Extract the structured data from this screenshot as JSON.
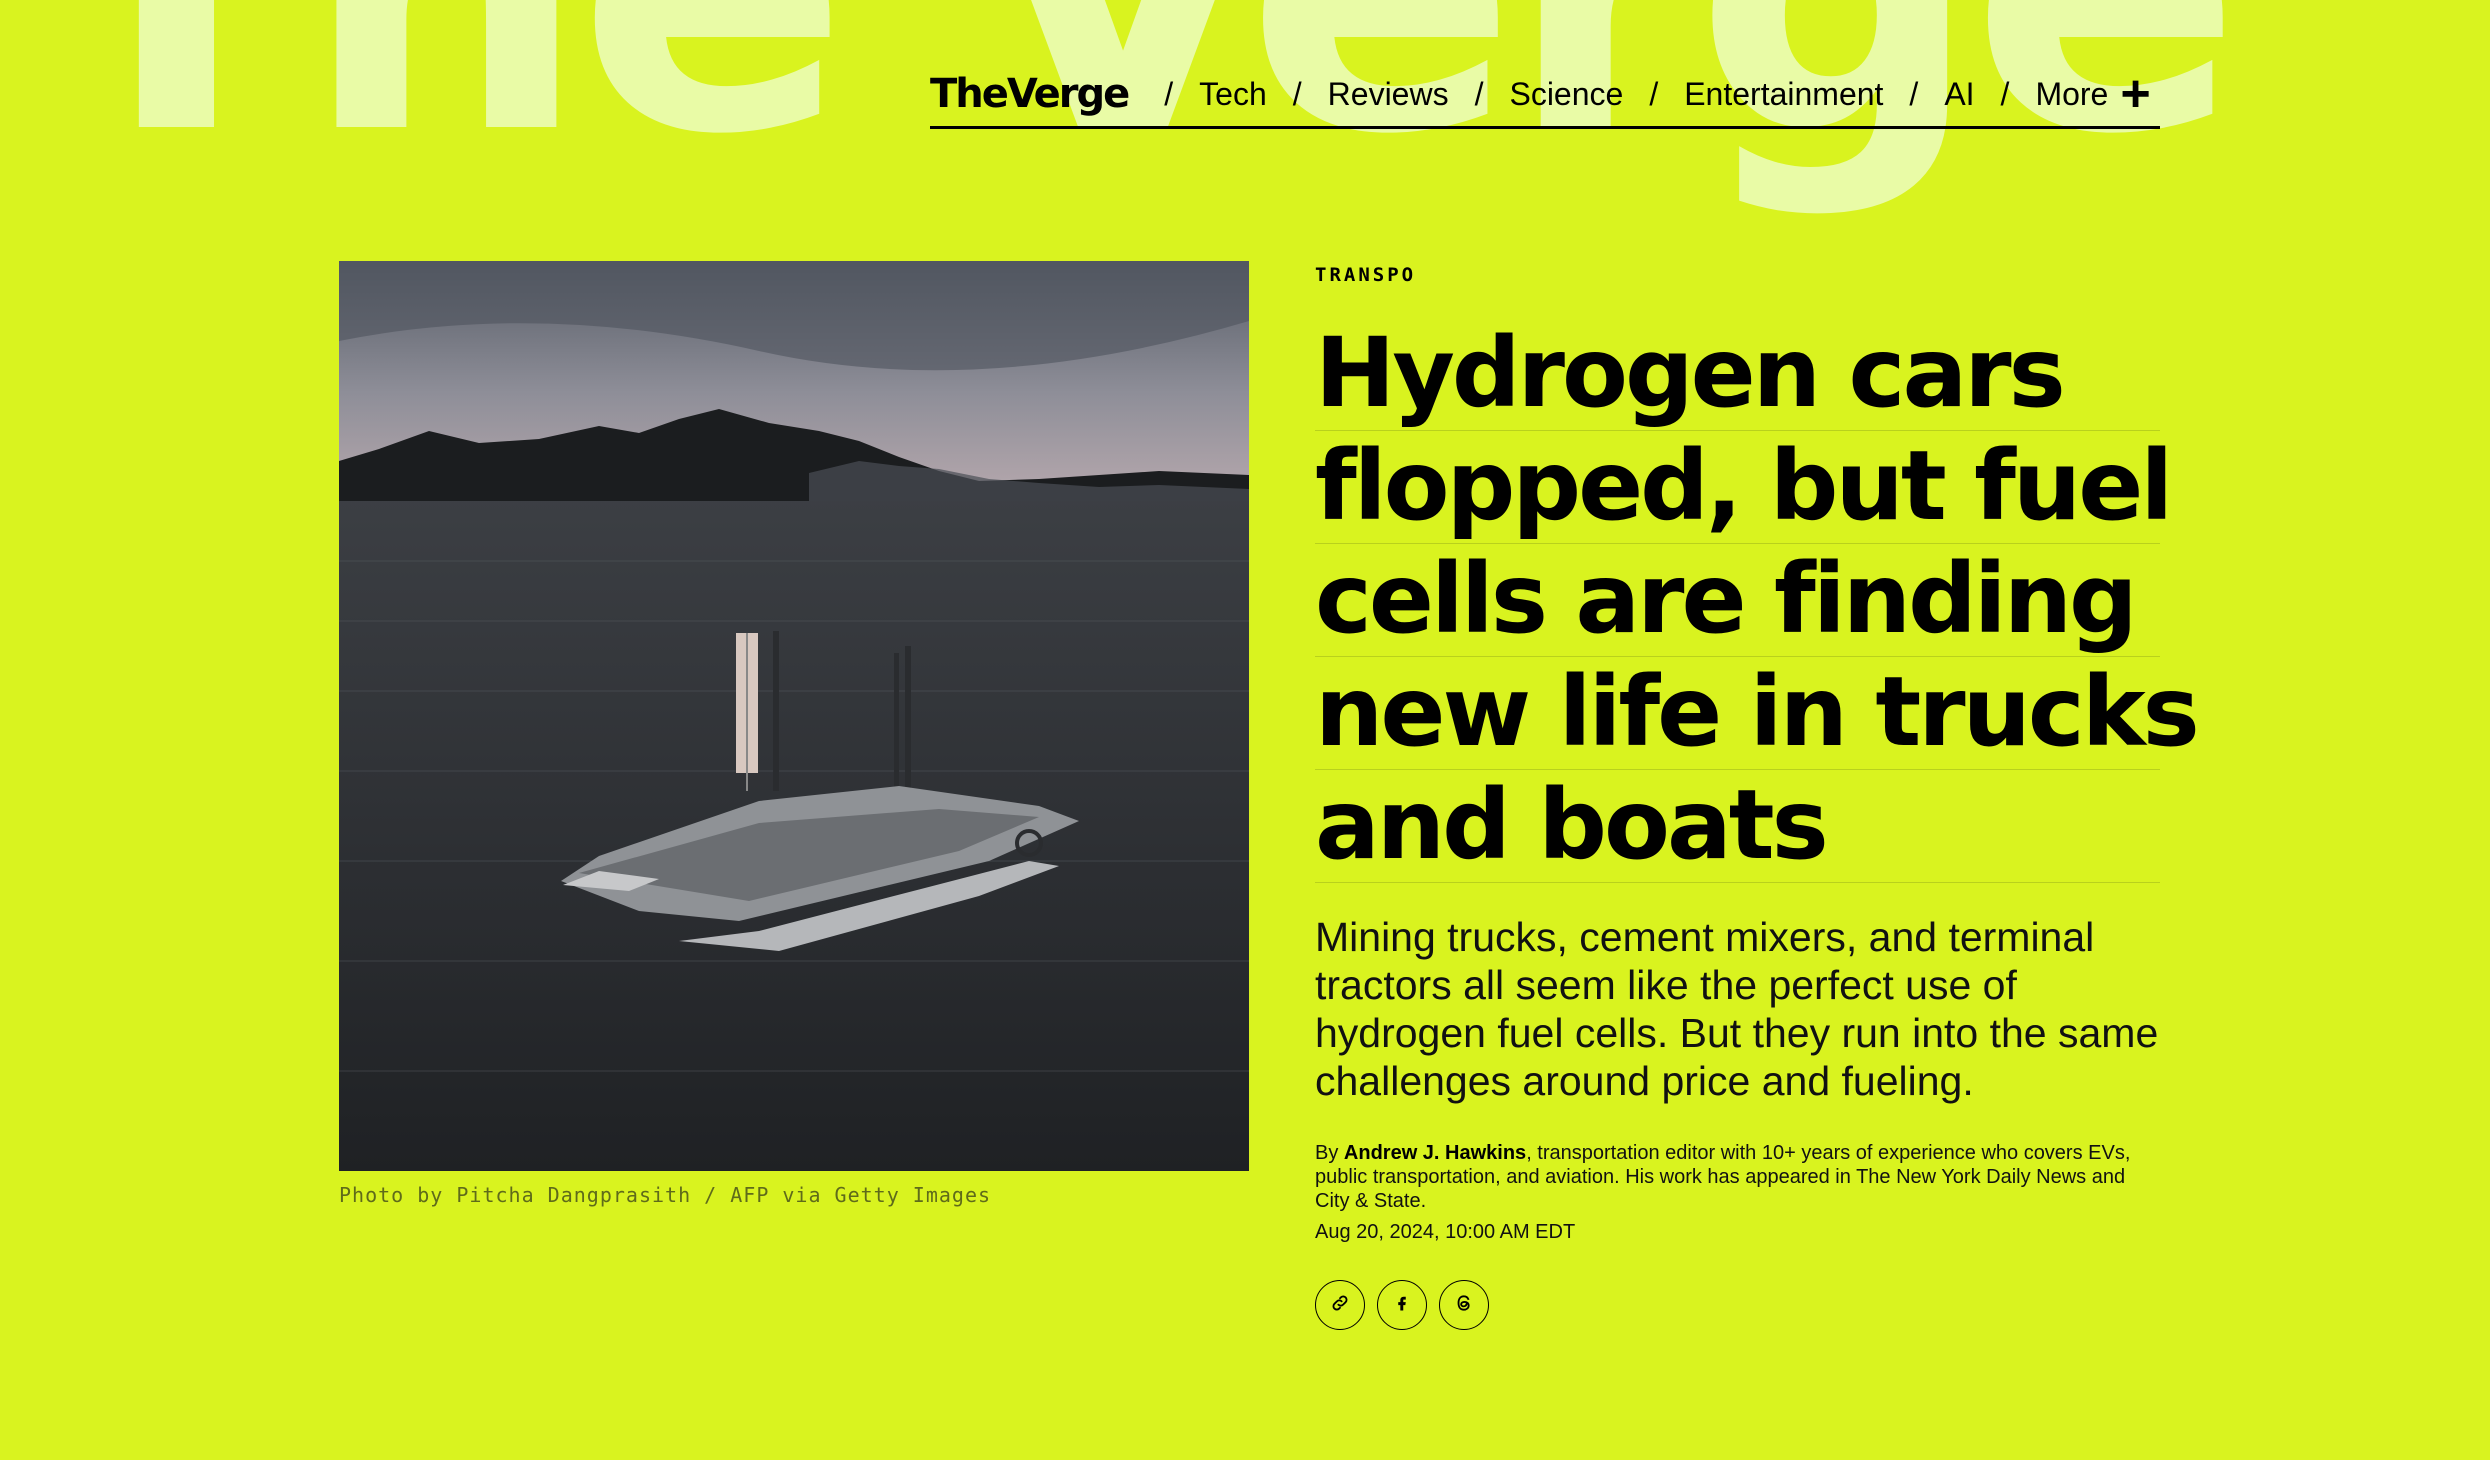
{
  "background_wordmark": "The Verge",
  "nav": {
    "logo": "TheVerge",
    "items": [
      {
        "label": "Tech"
      },
      {
        "label": "Reviews"
      },
      {
        "label": "Science"
      },
      {
        "label": "Entertainment"
      },
      {
        "label": "AI"
      },
      {
        "label": "More"
      }
    ],
    "separator": "/"
  },
  "hero": {
    "caption": "Photo by Pitcha Dangprasith / AFP via Getty Images"
  },
  "article": {
    "kicker": "TRANSPO",
    "headline_lines": [
      "Hydrogen cars",
      "flopped, but fuel",
      "cells are finding",
      "new life in trucks",
      "and boats"
    ],
    "dek": "Mining trucks, cement mixers, and terminal tractors all seem like the perfect use of hydrogen fuel cells. But they run into the same challenges around price and fueling.",
    "byline": {
      "prefix": "By ",
      "author": "Andrew J. Hawkins",
      "bio": ", transportation editor with 10+ years of experience who covers EVs, public transportation, and aviation. His work has appeared in The New York Daily News and City & State."
    },
    "date": "Aug 20, 2024, 10:00 AM EDT"
  },
  "share_icons": [
    "link-icon",
    "facebook-icon",
    "threads-icon"
  ],
  "colors": {
    "background": "#d9f31f",
    "wordmark": "#e9fba6",
    "text": "#000000"
  }
}
